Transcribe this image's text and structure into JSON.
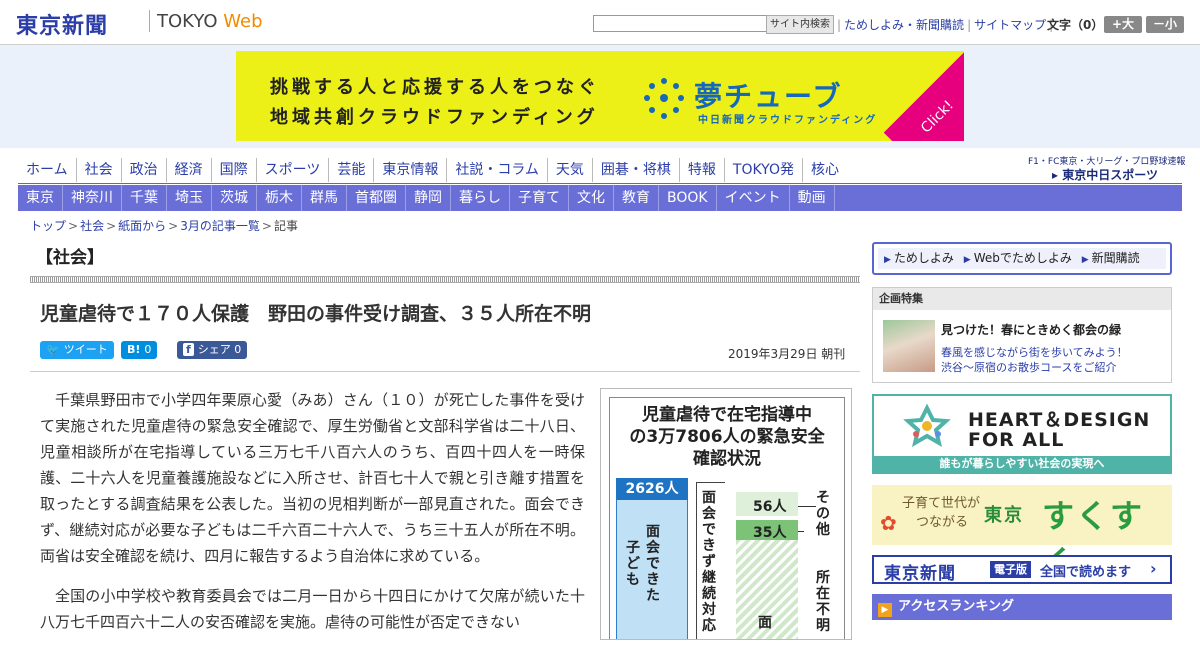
{
  "header": {
    "logo": "東京新聞",
    "logo_sub": "TOKYO",
    "logo_sub_web": "Web",
    "search_placeholder": "",
    "search_button": "サイト内検索",
    "links": [
      "ためしよみ・新聞購読",
      "サイトマップ"
    ],
    "font_size_label": "文字（0）",
    "font_bigger": "+大",
    "font_smaller": "－小"
  },
  "banner": {
    "line1": "挑戦する人と応援する人をつなぐ",
    "line2": "地域共創クラウドファンディング",
    "brand": "夢チューブ",
    "brand_sub": "中日新聞クラウドファンディング",
    "click": "Click!",
    "bg_color": "#ecf017",
    "accent_color": "#e6007e"
  },
  "nav_primary": [
    "ホーム",
    "社会",
    "政治",
    "経済",
    "国際",
    "スポーツ",
    "芸能",
    "東京情報",
    "社説・コラム",
    "天気",
    "囲碁・将棋",
    "特報",
    "TOKYO発",
    "核心"
  ],
  "sports_logo": {
    "line1": "F1・FC東京・大リーグ・プロ野球速報",
    "line2": "▸ 東京中日スポーツ"
  },
  "nav_regional": [
    "東京",
    "神奈川",
    "千葉",
    "埼玉",
    "茨城",
    "栃木",
    "群馬",
    "首都圏",
    "静岡",
    "暮らし",
    "子育て",
    "文化",
    "教育",
    "BOOK",
    "イベント",
    "動画"
  ],
  "breadcrumb": [
    "トップ",
    "社会",
    "紙面から",
    "3月の記事一覧",
    "記事"
  ],
  "section_title": "【社会】",
  "article": {
    "title": "児童虐待で１７０人保護　野田の事件受け調査、３５人所在不明",
    "share": {
      "tweet": "ツイート",
      "hatena": "B!",
      "hatena_count": "0",
      "facebook_icon": "f",
      "facebook": "シェア",
      "facebook_count": "0"
    },
    "date": "2019年3月29日 朝刊",
    "paragraphs": [
      "千葉県野田市で小学四年栗原心愛（みあ）さん（１０）が死亡した事件を受けて実施された児童虐待の緊急安全確認で、厚生労働省と文部科学省は二十八日、児童相談所が在宅指導している三万七千八百六人のうち、百四十四人を一時保護、二十六人を児童養護施設などに入所させ、計百七十人で親と引き離す措置を取ったとする調査結果を公表した。当初の児相判断が一部見直された。面会できず、継続対応が必要な子どもは二千六百二十六人で、うち三十五人が所在不明。両省は安全確認を続け、四月に報告するよう自治体に求めている。",
      "全国の小中学校や教育委員会では二月一日から十四日にかけて欠席が続いた十八万七千四百六十二人の安否確認を実施。虐待の可能性が否定できない"
    ]
  },
  "figure": {
    "title_lines": [
      "児童虐待で在宅指導中",
      "の3万7806人の緊急安全",
      "確認状況"
    ],
    "left_value": "2626人",
    "left_label_a": "面会できた",
    "left_label_b": "子ども",
    "mid_label": "面会できず継続対応",
    "green_top_value": "56人",
    "green_value": "35人",
    "green_label": "面",
    "right_label_a": "その他",
    "right_label_b": "所在不明"
  },
  "chart_data": {
    "type": "bar",
    "title": "児童虐待で在宅指導中の3万7806人の緊急安全確認状況",
    "categories": [
      "面会できず継続対応",
      "その他",
      "所在不明"
    ],
    "values": [
      2626,
      56,
      35
    ],
    "unit": "人"
  },
  "sidebar": {
    "subscribe": [
      "ためしよみ",
      "Webでためしよみ",
      "新聞購読"
    ],
    "kikaku_head": "企画特集",
    "kikaku_title": "見つけた！春にときめく都会の緑",
    "kikaku_desc1": "春風を感じながら街を歩いてみよう！",
    "kikaku_desc2": "渋谷～原宿のお散歩コースをご紹介",
    "heart_title1": "HEART＆DESIGN",
    "heart_title2": "FOR ALL",
    "heart_band": "誰もが暮らしやすい社会の実現へ",
    "suku_small1": "子育て世代が",
    "suku_small2": "つながる",
    "suku_tokyo": "東京",
    "suku_main": "すくすく",
    "epaper_logo": "東京新聞",
    "epaper_tag": "電子版",
    "epaper_text": "全国で読めます",
    "ranking": "アクセスランキング"
  }
}
